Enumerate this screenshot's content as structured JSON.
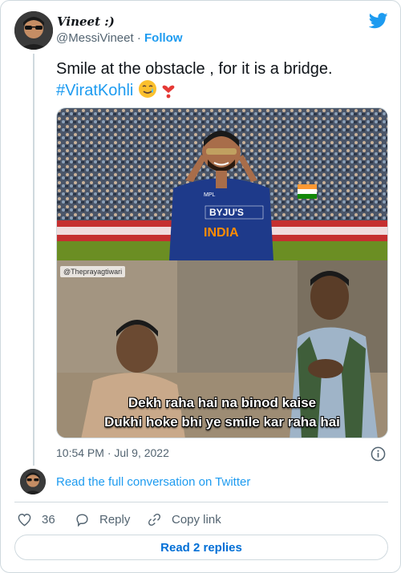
{
  "author": {
    "name": "Vineet :)",
    "handle": "@MessiVineet",
    "separator": "·",
    "follow_label": "Follow"
  },
  "tweet": {
    "text": "Smile at the obstacle , for it is a bridge.",
    "hashtag": "#ViratKohli",
    "emoji": "🥲❣️"
  },
  "media": {
    "watermark": "@Theprayagtiwari",
    "jersey_text_1": "BYJU'S",
    "jersey_text_2": "INDIA",
    "jersey_text_3": "MPL",
    "caption_line_1": "Dekh raha hai na binod kaise",
    "caption_line_2": "Dukhi hoke bhi ye smile kar raha hai"
  },
  "timestamp": "10:54 PM · Jul 9, 2022",
  "read_conversation": "Read the full conversation on Twitter",
  "actions": {
    "like_count": "36",
    "reply_label": "Reply",
    "copy_label": "Copy link"
  },
  "read_replies": "Read 2 replies",
  "colors": {
    "accent": "#1d9bf0",
    "text_secondary": "#536471",
    "border": "#cfd9de"
  },
  "icons": [
    "twitter-bird-icon",
    "info-icon",
    "heart-icon",
    "reply-icon",
    "link-icon"
  ]
}
